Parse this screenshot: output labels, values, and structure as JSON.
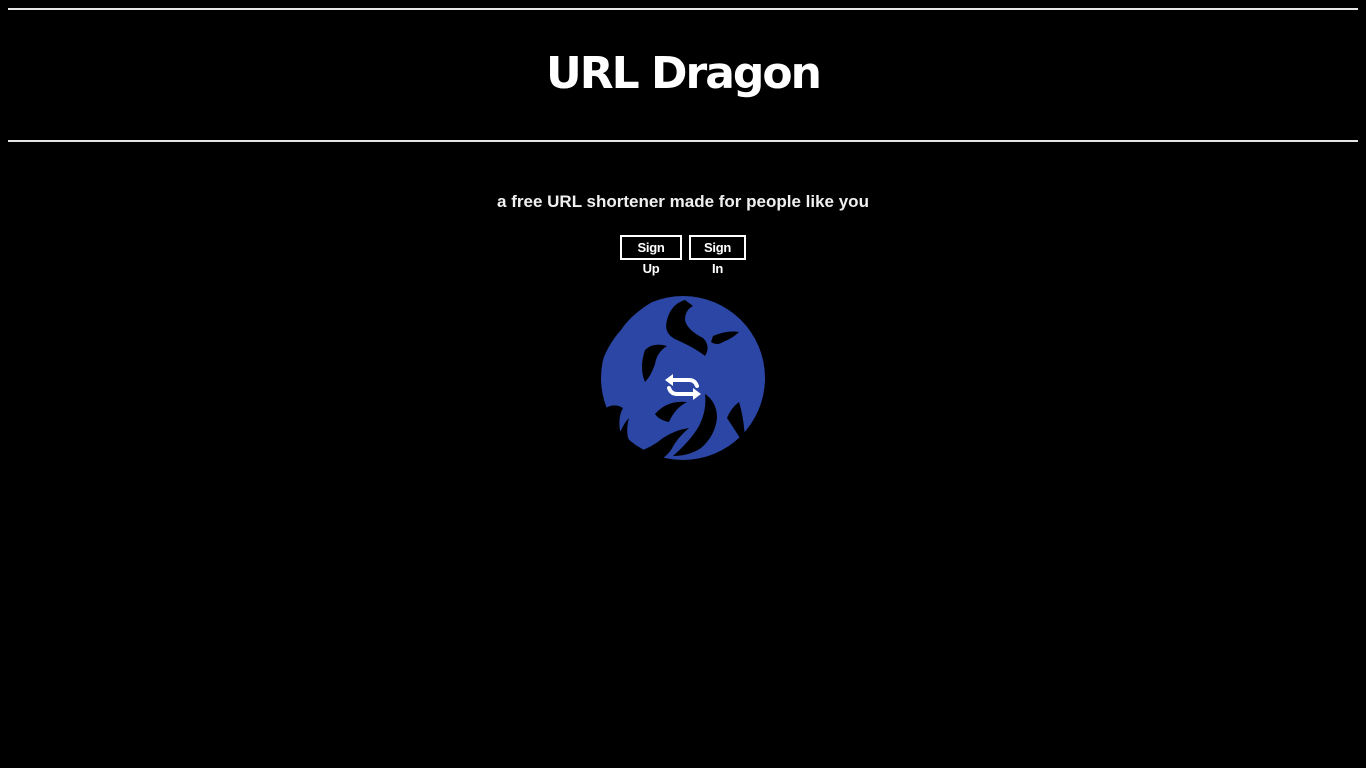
{
  "header": {
    "title": "URL Dragon"
  },
  "main": {
    "tagline": "a free URL shortener made for people like you",
    "buttons": {
      "sign_up_label": "Sign Up",
      "sign_in_label": "Sign In"
    },
    "logo": {
      "icon": "dragon-logo-icon",
      "color": "#2b46a4"
    }
  },
  "colors": {
    "background": "#000000",
    "text": "#ffffff",
    "accent": "#2b46a4"
  }
}
